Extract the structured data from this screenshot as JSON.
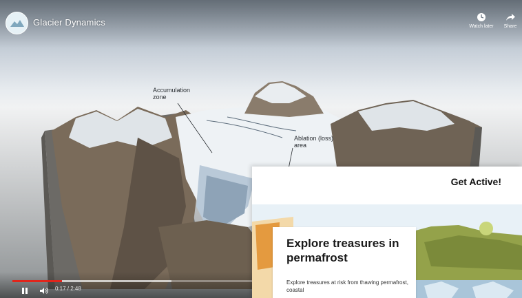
{
  "video": {
    "channel_logo_icon": "channel-logo",
    "title": "Glacier Dynamics",
    "actions": [
      {
        "label": "Watch later",
        "icon": "clock-icon"
      },
      {
        "label": "Share",
        "icon": "share-arrow-icon"
      }
    ],
    "annotations": {
      "accumulation": "Accumulation zone",
      "ablation": "Ablation (loss) area"
    },
    "controls": {
      "time": "0:17 / 2:48",
      "progress_played": 0.1,
      "progress_buffered": 0.32,
      "play_state": "playing"
    },
    "colors": {
      "progress": "#e1251b"
    }
  },
  "panel": {
    "title": "Get Active!",
    "card": {
      "heading": "Explore treasures in permafrost",
      "body": "Explore treasures at risk from thawing permafrost, coastal"
    }
  }
}
